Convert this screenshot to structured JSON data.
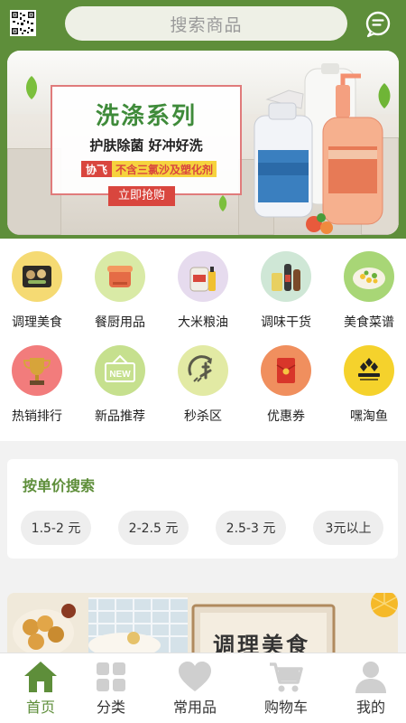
{
  "header": {
    "search_placeholder": "搜索商品",
    "qr_icon": "qr-code-icon",
    "message_icon": "message-bubble-icon",
    "brand_color": "#5e8e3a"
  },
  "banner": {
    "title": "洗涤系列",
    "subtitle": "护肤除菌  好冲好洗",
    "brand": "协飞",
    "feature": "不含三氯沙及塑化剂",
    "cta": "立即抢购"
  },
  "categories": [
    {
      "label": "调理美食",
      "icon": "prepared-food-icon"
    },
    {
      "label": "餐厨用品",
      "icon": "kitchenware-icon"
    },
    {
      "label": "大米粮油",
      "icon": "rice-oil-icon"
    },
    {
      "label": "调味干货",
      "icon": "seasoning-icon"
    },
    {
      "label": "美食菜谱",
      "icon": "recipe-icon"
    },
    {
      "label": "热销排行",
      "icon": "trophy-icon"
    },
    {
      "label": "新品推荐",
      "icon": "new-badge-icon"
    },
    {
      "label": "秒杀区",
      "icon": "flash-sale-icon"
    },
    {
      "label": "优惠券",
      "icon": "red-envelope-icon"
    },
    {
      "label": "嘿淘鱼",
      "icon": "hetaoyu-logo-icon"
    }
  ],
  "price_search": {
    "title": "按单价搜索",
    "options": [
      "1.5-2 元",
      "2-2.5 元",
      "2.5-3 元",
      "3元以上"
    ]
  },
  "promo2": {
    "sign_text": "调理美食"
  },
  "tabbar": {
    "active_color": "#5e8e3a",
    "tabs": [
      {
        "label": "首页",
        "icon": "home-icon",
        "active": true
      },
      {
        "label": "分类",
        "icon": "category-grid-icon",
        "active": false
      },
      {
        "label": "常用品",
        "icon": "heart-icon",
        "active": false
      },
      {
        "label": "购物车",
        "icon": "cart-icon",
        "active": false
      },
      {
        "label": "我的",
        "icon": "user-icon",
        "active": false
      }
    ]
  }
}
